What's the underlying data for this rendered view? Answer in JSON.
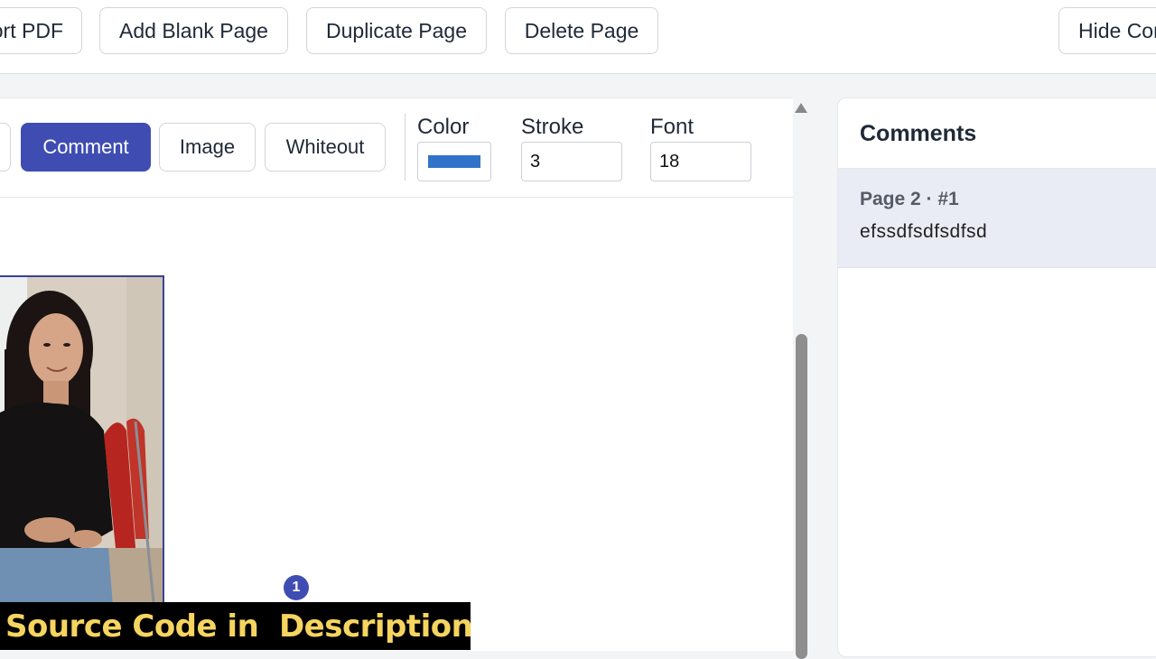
{
  "toolbar": {
    "export_label": "Export PDF",
    "add_blank_label": "Add Blank Page",
    "duplicate_label": "Duplicate Page",
    "delete_label": "Delete Page",
    "hide_comments_label": "Hide Comments"
  },
  "editor": {
    "modes": {
      "comment": "Comment",
      "image": "Image",
      "whiteout": "Whiteout"
    },
    "active_mode": "Comment",
    "color_label": "Color",
    "stroke_label": "Stroke",
    "font_label": "Font",
    "color_value": "#2f74c8",
    "stroke_value": "3",
    "font_value": "18",
    "comment_marker": "1"
  },
  "comments": {
    "title": "Comments",
    "items": [
      {
        "meta": "Page 2 · #1",
        "text": "efssdfsdfsdfsd"
      }
    ]
  },
  "overlay": {
    "banner_text": "Source Code in  Description"
  },
  "colors": {
    "accent": "#3f4db3",
    "banner_text": "#f5d55f",
    "banner_bg": "#000000"
  }
}
